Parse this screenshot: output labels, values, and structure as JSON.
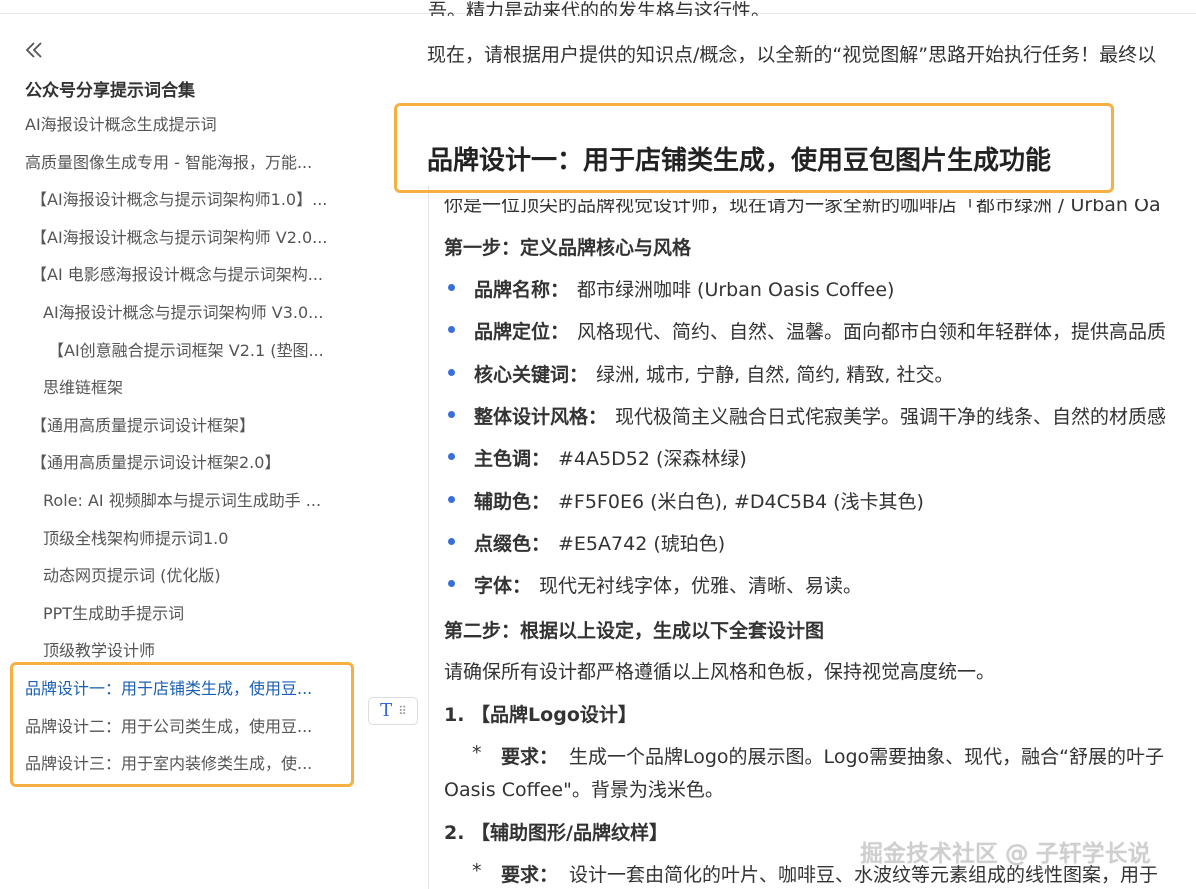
{
  "sidebar": {
    "title": "公众号分享提示词合集",
    "items": [
      {
        "label": "AI海报设计概念生成提示词",
        "indent": 0,
        "active": false
      },
      {
        "label": "高质量图像生成专用 - 智能海报，万能...",
        "indent": 0,
        "active": false
      },
      {
        "label": "【AI海报设计概念与提示词架构师1.0】...",
        "indent": 1,
        "active": false
      },
      {
        "label": "【AI海报设计概念与提示词架构师 V2.0...",
        "indent": 1,
        "active": false
      },
      {
        "label": "【AI 电影感海报设计概念与提示词架构...",
        "indent": 1,
        "active": false
      },
      {
        "label": "AI海报设计概念与提示词架构师 V3.0...",
        "indent": 2,
        "active": false
      },
      {
        "label": "【AI创意融合提示词框架 V2.1 (垫图...",
        "indent": 3,
        "active": false
      },
      {
        "label": "思维链框架",
        "indent": 2,
        "active": false
      },
      {
        "label": "【通用高质量提示词设计框架】",
        "indent": 1,
        "active": false
      },
      {
        "label": "【通用高质量提示词设计框架2.0】",
        "indent": 1,
        "active": false
      },
      {
        "label": "Role: AI 视频脚本与提示词生成助手 ...",
        "indent": 2,
        "active": false
      },
      {
        "label": "顶级全栈架构师提示词1.0",
        "indent": 2,
        "active": false
      },
      {
        "label": "动态网页提示词 (优化版)",
        "indent": 2,
        "active": false
      },
      {
        "label": "PPT生成助手提示词",
        "indent": 2,
        "active": false
      },
      {
        "label": "顶级教学设计师",
        "indent": 2,
        "active": false
      },
      {
        "label": "品牌设计一：用于店铺类生成，使用豆...",
        "indent": 0,
        "active": true
      },
      {
        "label": "品牌设计二：用于公司类生成，使用豆...",
        "indent": 0,
        "active": false
      },
      {
        "label": "品牌设计三：用于室内装修类生成，使...",
        "indent": 0,
        "active": false
      }
    ]
  },
  "content": {
    "prev_line_cut": "吾。精力是动来代的的发生格与这行性。",
    "prev_line": "现在，请根据用户提供的知识点/概念，以全新的“视觉图解”思路开始执行任务！最终以",
    "heading": "品牌设计一：用于店铺类生成，使用豆包图片生成功能",
    "intro": "你是一位顶尖的品牌视觉设计师，现在请为一家全新的咖啡店「都市绿洲 / Urban Oa",
    "step1": "第一步：定义品牌核心与风格",
    "bullets": [
      {
        "label": "品牌名称：",
        "value": "都市绿洲咖啡 (Urban Oasis Coffee)"
      },
      {
        "label": "品牌定位：",
        "value": "风格现代、简约、自然、温馨。面向都市白领和年轻群体，提供高品质"
      },
      {
        "label": "核心关键词：",
        "value": "绿洲, 城市, 宁静, 自然, 简约, 精致, 社交。"
      },
      {
        "label": "整体设计风格：",
        "value": "现代极简主义融合日式侘寂美学。强调干净的线条、自然的材质感"
      },
      {
        "label": "主色调：",
        "value": "#4A5D52 (深森林绿)"
      },
      {
        "label": "辅助色：",
        "value": "#F5F0E6 (米白色), #D4C5B4 (浅卡其色)"
      },
      {
        "label": "点缀色：",
        "value": "#E5A742 (琥珀色)"
      },
      {
        "label": "字体：",
        "value": "现代无衬线字体，优雅、清晰、易读。"
      }
    ],
    "step2": "第二步：根据以上设定，生成以下全套设计图",
    "step2_desc": "请确保所有设计都严格遵循以上风格和色板，保持视觉高度统一。",
    "sub1_title": "1. 【品牌Logo设计】",
    "sub1_star": "*",
    "sub1_label": "要求：",
    "sub1_text": "生成一个品牌Logo的展示图。Logo需要抽象、现代，融合“舒展的叶子",
    "sub1_cont": "Oasis Coffee\"。背景为浅米色。",
    "sub2_title": "2. 【辅助图形/品牌纹样】",
    "sub2_star": "*",
    "sub2_label": "要求：",
    "sub2_text": "设计一套由简化的叶片、咖啡豆、水波纹等元素组成的线性图案，用于"
  },
  "watermark": "掘金技术社区 @ 子轩学长说",
  "icons": {
    "collapse": "double-chevron-left-icon",
    "text_tool": "text-format-icon",
    "drag": "drag-handle-icon"
  },
  "colors": {
    "highlight": "#f5b041",
    "link": "#1a5fb4",
    "bullet": "#3a6fd8"
  }
}
